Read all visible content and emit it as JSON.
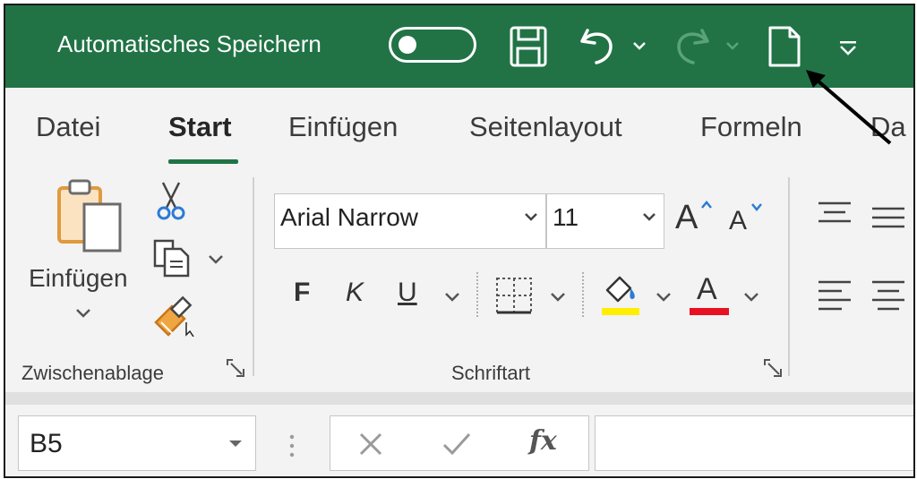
{
  "titlebar": {
    "autosave_label": "Automatisches Speichern",
    "autosave_state": "off",
    "quick_access": [
      "save-icon",
      "undo-icon",
      "redo-icon",
      "new-document-icon",
      "customize-qat-icon"
    ],
    "accent_color": "#217346"
  },
  "tabs": {
    "items": [
      "Datei",
      "Start",
      "Einfügen",
      "Seitenlayout",
      "Formeln",
      "Da"
    ],
    "active": "Start"
  },
  "ribbon": {
    "clipboard": {
      "paste_label": "Einfügen",
      "group_label": "Zwischenablage",
      "icons": [
        "paste-icon",
        "cut-icon",
        "copy-icon",
        "format-painter-icon"
      ]
    },
    "font": {
      "font_name": "Arial Narrow",
      "font_size": "11",
      "grow_label": "A",
      "shrink_label": "A",
      "bold_label": "F",
      "italic_label": "K",
      "underline_label": "U",
      "font_color_label": "A",
      "highlight_color": "#ffee00",
      "font_color": "#e81123",
      "group_label": "Schriftart"
    },
    "alignment": {
      "icons": [
        "align-top-icon",
        "align-middle-icon",
        "align-left-icon",
        "align-center-icon"
      ]
    }
  },
  "formulabar": {
    "namebox_value": "B5",
    "fx_label": "fx",
    "icons": [
      "cancel-icon",
      "enter-icon",
      "insert-function-icon"
    ],
    "formula_value": ""
  },
  "annotation": {
    "arrow_target": "new-document-icon"
  }
}
